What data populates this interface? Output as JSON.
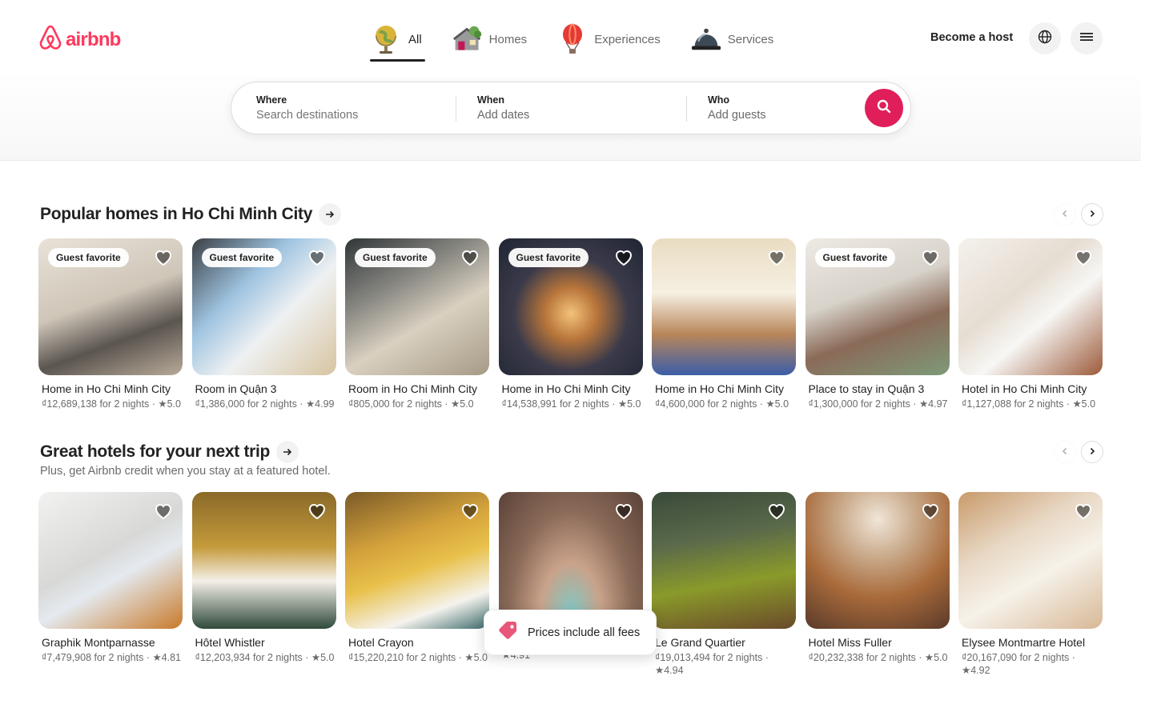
{
  "brand": {
    "name": "airbnb",
    "color": "#ff385c"
  },
  "nav": {
    "tabs": [
      {
        "label": "All",
        "icon": "globe-icon",
        "active": true
      },
      {
        "label": "Homes",
        "icon": "house-icon",
        "active": false
      },
      {
        "label": "Experiences",
        "icon": "hot-air-balloon-icon",
        "active": false
      },
      {
        "label": "Services",
        "icon": "service-bell-icon",
        "active": false
      }
    ]
  },
  "header_actions": {
    "become_host": "Become a host",
    "language_icon": "globe-icon",
    "menu_icon": "hamburger-menu-icon"
  },
  "search": {
    "where_label": "Where",
    "where_placeholder": "Search destinations",
    "when_label": "When",
    "when_placeholder": "Add dates",
    "who_label": "Who",
    "who_placeholder": "Add guests",
    "button_icon": "search-icon",
    "button_color": "#e01e5a"
  },
  "sections": [
    {
      "title": "Popular homes in Ho Chi Minh City",
      "cards": [
        {
          "badge": "Guest favorite",
          "title": "Home in Ho Chi Minh City",
          "meta": "₫12,689,138 for 2 nights · ★5.0"
        },
        {
          "badge": "Guest favorite",
          "title": "Room in Quận 3",
          "meta": "₫1,386,000 for 2 nights · ★4.99"
        },
        {
          "badge": "Guest favorite",
          "title": "Room in Ho Chi Minh City",
          "meta": "₫805,000 for 2 nights · ★5.0"
        },
        {
          "badge": "Guest favorite",
          "title": "Home in Ho Chi Minh City",
          "meta": "₫14,538,991 for 2 nights · ★5.0"
        },
        {
          "badge": "",
          "title": "Home in Ho Chi Minh City",
          "meta": "₫4,600,000 for 2 nights · ★5.0"
        },
        {
          "badge": "Guest favorite",
          "title": "Place to stay in Quận 3",
          "meta": "₫1,300,000 for 2 nights · ★4.97"
        },
        {
          "badge": "",
          "title": "Hotel in Ho Chi Minh City",
          "meta": "₫1,127,088 for 2 nights · ★5.0"
        }
      ]
    },
    {
      "title": "Great hotels for your next trip",
      "subtitle": "Plus, get Airbnb credit when you stay at a featured hotel.",
      "cards": [
        {
          "title": "Graphik Montparnasse",
          "meta": "₫7,479,908 for 2 nights · ★4.81"
        },
        {
          "title": "Hôtel Whistler",
          "meta": "₫12,203,934 for 2 nights · ★5.0"
        },
        {
          "title": "Hotel Crayon",
          "meta": "₫15,220,210 for 2 nights · ★5.0"
        },
        {
          "title": "",
          "meta": "₫16,627,998 for 2 nights · ★4.91"
        },
        {
          "title": "Le Grand Quartier",
          "meta": "₫19,013,494 for 2 nights · ★4.94"
        },
        {
          "title": "Hotel Miss Fuller",
          "meta": "₫20,232,338 for 2 nights · ★5.0"
        },
        {
          "title": "Elysee Montmartre Hotel",
          "meta": "₫20,167,090 for 2 nights · ★4.92"
        }
      ]
    }
  ],
  "fees_banner": {
    "text": "Prices include all fees",
    "icon": "price-tag-icon"
  }
}
